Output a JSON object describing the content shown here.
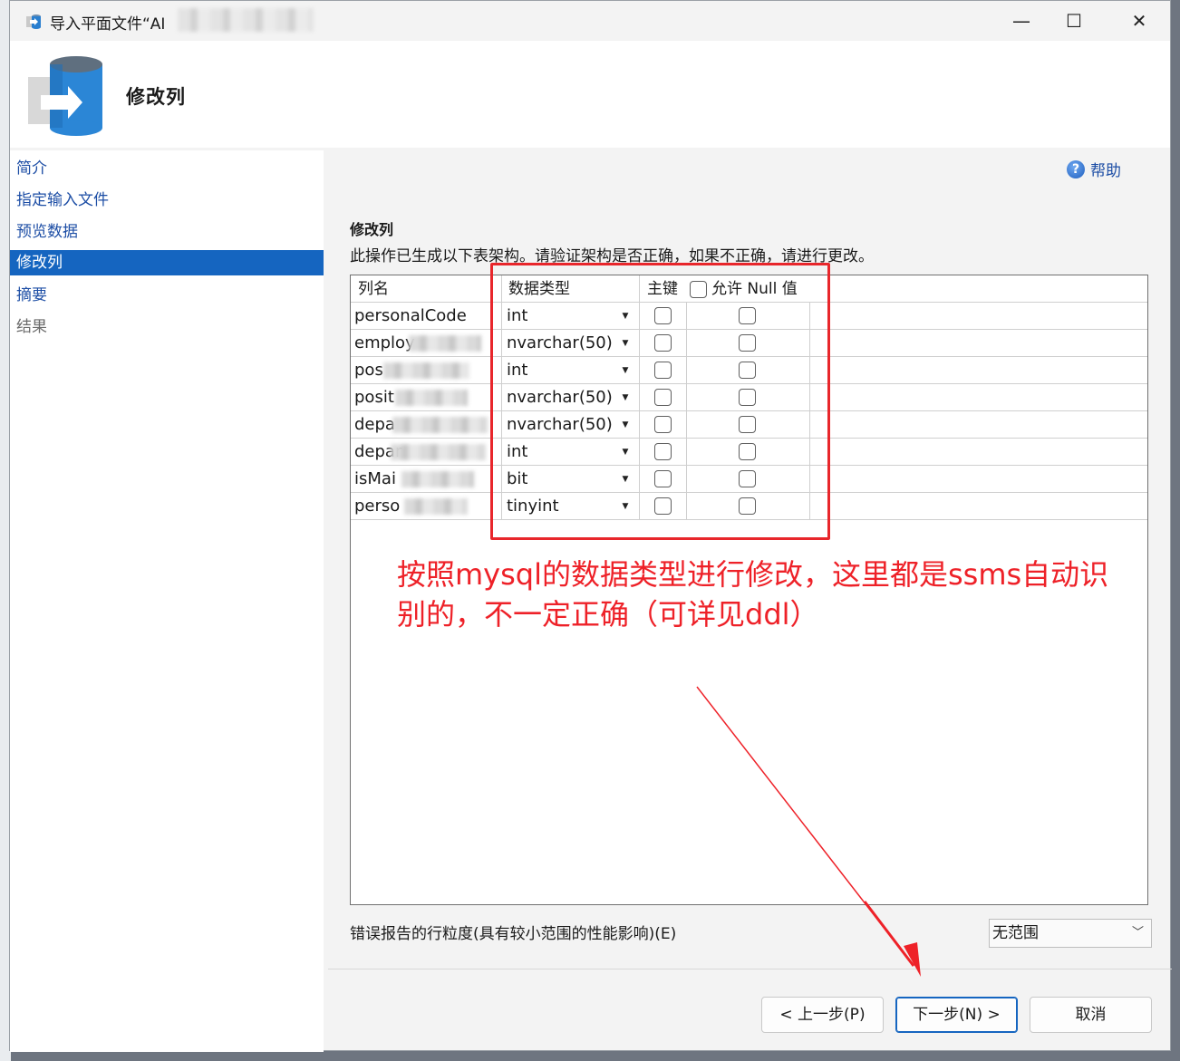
{
  "window": {
    "title": "导入平面文件“AI",
    "minimize_glyph": "—",
    "maximize_glyph": "☐",
    "close_glyph": "✕"
  },
  "header": {
    "title": "修改列"
  },
  "nav": {
    "items": [
      {
        "label": "简介"
      },
      {
        "label": "指定输入文件"
      },
      {
        "label": "预览数据"
      },
      {
        "label": "修改列"
      },
      {
        "label": "摘要"
      },
      {
        "label": "结果"
      }
    ]
  },
  "help": {
    "label": "帮助",
    "icon_glyph": "?"
  },
  "section": {
    "title": "修改列",
    "description": "此操作已生成以下表架构。请验证架构是否正确，如果不正确，请进行更改。"
  },
  "grid": {
    "headers": {
      "column_name": "列名",
      "data_type": "数据类型",
      "primary_key": "主键",
      "allow_null": "允许 Null 值"
    },
    "dropdown_glyph": "▼",
    "rows": [
      {
        "name": "personalCode",
        "type": "int"
      },
      {
        "name": "employ",
        "type": "nvarchar(50)"
      },
      {
        "name": "pos",
        "type": "int"
      },
      {
        "name": "posit",
        "type": "nvarchar(50)"
      },
      {
        "name": "depa",
        "type": "nvarchar(50)"
      },
      {
        "name": "depar",
        "type": "int"
      },
      {
        "name": "isMai",
        "type": "bit"
      },
      {
        "name": "perso",
        "type": "tinyint"
      }
    ]
  },
  "annotation": {
    "text": "按照mysql的数据类型进行修改，这里都是ssms自动识别的，不一定正确（可详见ddl）",
    "color": "#ee2128"
  },
  "error_report": {
    "label": "错误报告的行粒度(具有较小范围的性能影响)(E)",
    "selected": "无范围"
  },
  "buttons": {
    "previous": "< 上一步(P)",
    "next": "下一步(N) >",
    "cancel": "取消"
  },
  "colors": {
    "nav_active": "#1565c0",
    "link": "#1d4ea5",
    "annotation": "#e8262b"
  }
}
